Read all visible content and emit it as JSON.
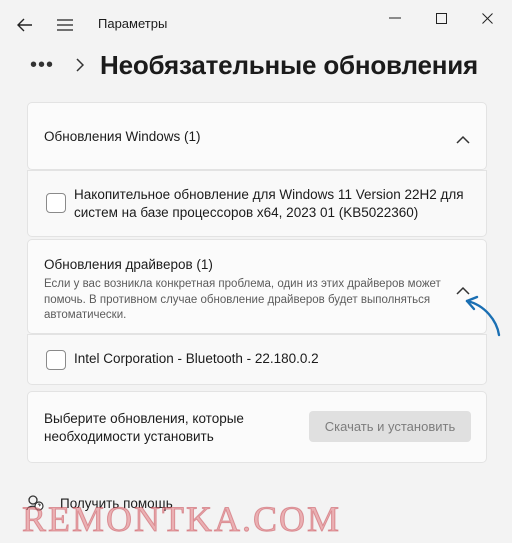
{
  "window": {
    "title": "Параметры",
    "back_icon": "back-arrow-icon",
    "menu_icon": "hamburger-menu-icon",
    "controls": [
      "minimize-icon",
      "maximize-icon",
      "close-icon"
    ]
  },
  "header": {
    "more": "•••",
    "title": "Необязательные обновления"
  },
  "sections": {
    "windows_updates": {
      "label": "Обновления Windows (1)",
      "expanded": true,
      "items": [
        {
          "label": "Накопительное обновление для Windows 11 Version 22H2 для систем на базе процессоров x64, 2023 01 (KB5022360)",
          "checked": false
        }
      ]
    },
    "driver_updates": {
      "label": "Обновления драйверов (1)",
      "description": "Если у вас возникла конкретная проблема, один из этих драйверов может помочь. В противном случае обновление драйверов будет выполняться автоматически.",
      "expanded": true,
      "items": [
        {
          "label": "Intel Corporation - Bluetooth - 22.180.0.2",
          "checked": false
        }
      ]
    }
  },
  "install": {
    "prompt": "Выберите обновления, которые необходимости установить",
    "button_label": "Скачать и установить",
    "button_enabled": false
  },
  "help": {
    "label": "Получить помощь",
    "icon": "help-person-icon"
  },
  "watermark": "REMONTKA.COM",
  "colors": {
    "background": "#f3f3f3",
    "card": "#fbfbfb",
    "accent_arrow": "#1a6fb3",
    "button_disabled_bg": "#e0e0e0",
    "button_disabled_text": "#7d7d7d",
    "watermark": "#e1787d"
  }
}
